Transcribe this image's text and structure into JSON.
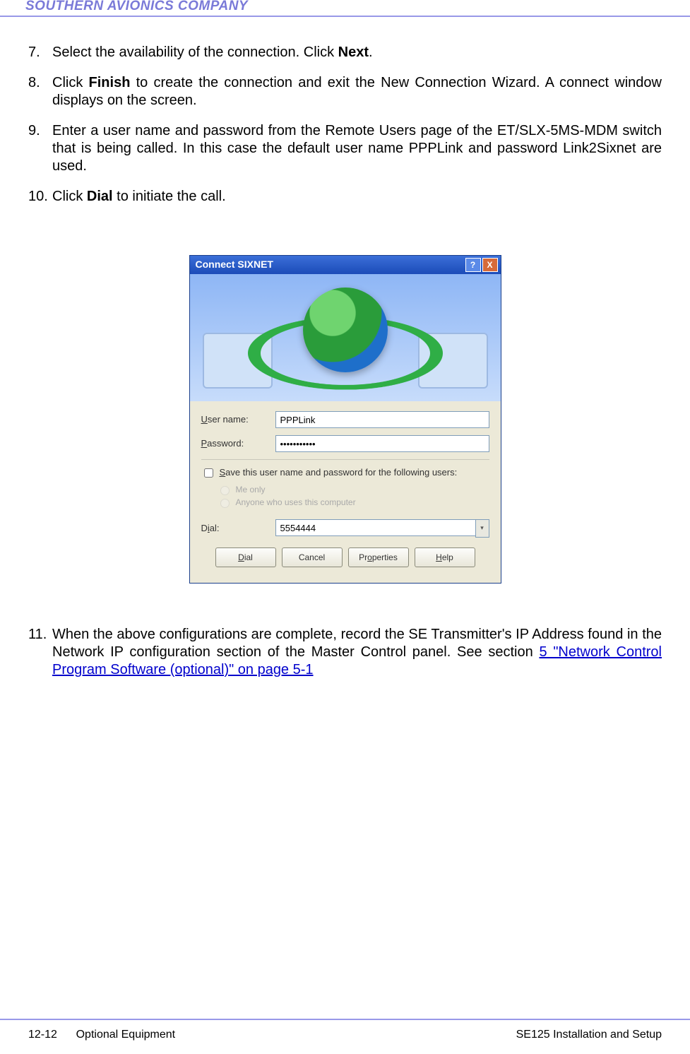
{
  "header": {
    "company": "SOUTHERN AVIONICS COMPANY"
  },
  "steps": {
    "s7": {
      "num": "7.",
      "text_a": "Select the availability of the connection. Click ",
      "bold": "Next",
      "text_b": "."
    },
    "s8": {
      "num": "8.",
      "text_a": "Click ",
      "bold": "Finish",
      "text_b": " to create the connection and exit the New Connection Wizard. A connect window displays on the screen."
    },
    "s9": {
      "num": "9.",
      "text": "Enter a user name and password from the Remote Users page of the ET/SLX-5MS-MDM switch that is being called. In this case the default user name PPPLink and password Link2Sixnet are used."
    },
    "s10": {
      "num": "10.",
      "text_a": "Click ",
      "bold": "Dial",
      "text_b": " to initiate the call."
    },
    "s11": {
      "num": "11.",
      "text_a": "When the above configurations are complete, record the SE Transmitter's IP Address found in the Network IP configuration section of the Master Control panel.  See section  ",
      "link": "5  \"Network Control Program Software (optional)\" on page 5-1"
    }
  },
  "dialog": {
    "title": "Connect SIXNET",
    "help_glyph": "?",
    "close_glyph": "X",
    "username_label": "User name:",
    "username_value": "PPPLink",
    "password_label": "Password:",
    "password_value": "•••••••••••",
    "save_label": "Save this user name and password for the following users:",
    "radio_me": "Me only",
    "radio_anyone": "Anyone who uses this computer",
    "dial_label": "Dial:",
    "dial_value": "5554444",
    "btn_dial": "Dial",
    "btn_cancel": "Cancel",
    "btn_properties": "Properties",
    "btn_help": "Help"
  },
  "footer": {
    "left_page": "12-12",
    "left_section": "Optional Equipment",
    "right": "SE125 Installation and Setup"
  }
}
